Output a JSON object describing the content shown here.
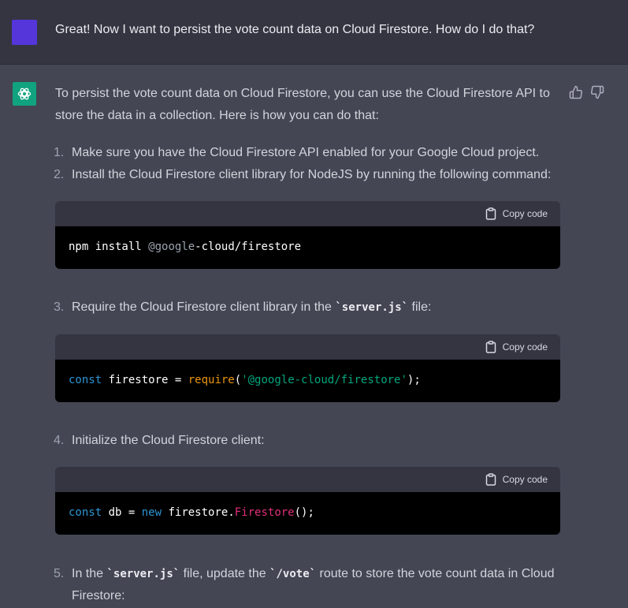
{
  "user_message": {
    "text": "Great! Now I want to persist the vote count data on Cloud Firestore. How do I do that?"
  },
  "assistant": {
    "intro_line1": "To persist the vote count data on Cloud Firestore, you can use the Cloud Firestore API to",
    "intro_line2": "store the data in a collection. Here is how you can do that:",
    "steps": [
      {
        "num": "1.",
        "text": "Make sure you have the Cloud Firestore API enabled for your Google Cloud project."
      },
      {
        "num": "2.",
        "text": "Install the Cloud Firestore client library for NodeJS by running the following command:"
      },
      {
        "num": "3.",
        "before": "Require the Cloud Firestore client library in the ",
        "code": "`server.js`",
        "after": " file:"
      },
      {
        "num": "4.",
        "text": "Initialize the Cloud Firestore client:"
      },
      {
        "num": "5.",
        "before": "In the ",
        "code1": "`server.js`",
        "middle": " file, update the ",
        "code2": "`/vote`",
        "after": " route to store the vote count data in Cloud",
        "line2": "Firestore:"
      }
    ],
    "copy_label": "Copy code",
    "code_blocks": [
      {
        "tokens": [
          "npm install ",
          "@google",
          "-cloud/firestore"
        ]
      },
      {
        "tokens": [
          "const",
          " firestore = ",
          "require",
          "(",
          "'@google-cloud/firestore'",
          ");"
        ]
      },
      {
        "tokens": [
          "const",
          " db = ",
          "new",
          " firestore.",
          "Firestore",
          "();"
        ]
      }
    ]
  },
  "colors": {
    "user_avatar": "#5436da",
    "bot_avatar": "#10a37f",
    "background": "#444654",
    "user_background": "#343541"
  },
  "icons": [
    "openai-logo-icon",
    "thumbs-up-icon",
    "thumbs-down-icon",
    "clipboard-icon"
  ]
}
